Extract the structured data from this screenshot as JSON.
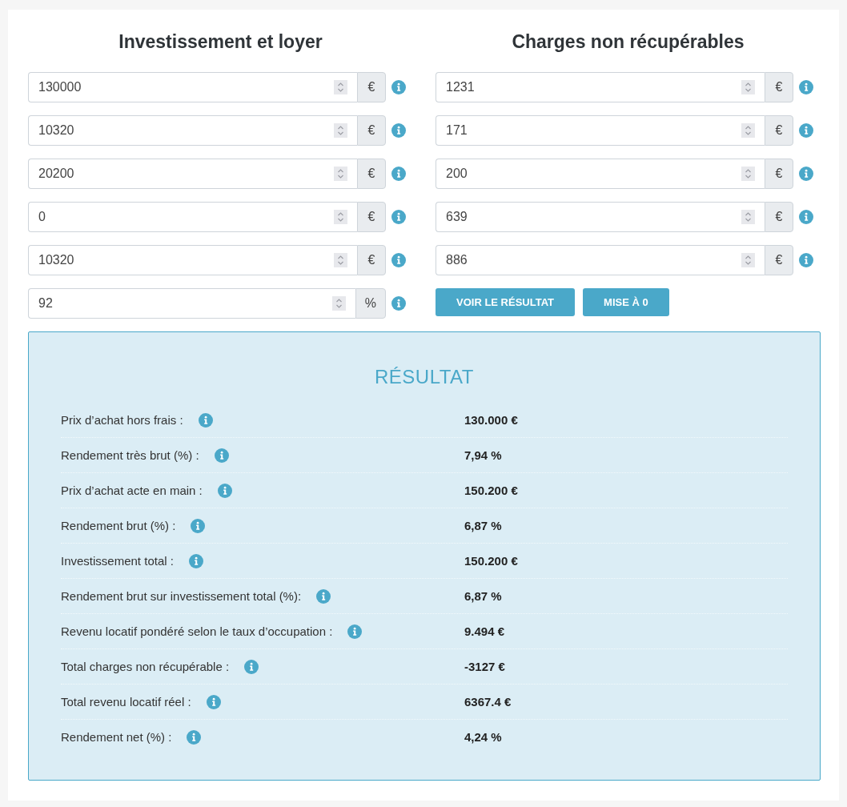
{
  "sections": [
    {
      "title": "Investissement et loyer",
      "fields": [
        {
          "value": "130000",
          "unit": "€"
        },
        {
          "value": "10320",
          "unit": "€"
        },
        {
          "value": "20200",
          "unit": "€"
        },
        {
          "value": "0",
          "unit": "€"
        },
        {
          "value": "10320",
          "unit": "€"
        },
        {
          "value": "92",
          "unit": "%"
        }
      ]
    },
    {
      "title": "Charges non récupérables",
      "fields": [
        {
          "value": "1231",
          "unit": "€"
        },
        {
          "value": "171",
          "unit": "€"
        },
        {
          "value": "200",
          "unit": "€"
        },
        {
          "value": "639",
          "unit": "€"
        },
        {
          "value": "886",
          "unit": "€"
        }
      ],
      "buttons": [
        {
          "label": "VOIR LE RÉSULTAT"
        },
        {
          "label": "MISE À 0"
        }
      ]
    }
  ],
  "result": {
    "title": "RÉSULTAT",
    "rows": [
      {
        "label": "Prix d’achat hors frais :",
        "value": "130.000 €"
      },
      {
        "label": "Rendement très brut (%) :",
        "value": "7,94 %"
      },
      {
        "label": "Prix d’achat acte en main :",
        "value": "150.200 €"
      },
      {
        "label": "Rendement brut (%) :",
        "value": "6,87 %"
      },
      {
        "label": "Investissement total :",
        "value": "150.200 €"
      },
      {
        "label": "Rendement brut sur investissement total (%):",
        "value": "6,87 %"
      },
      {
        "label": "Revenu locatif pondéré selon le taux d’occupation :",
        "value": "9.494 €"
      },
      {
        "label": "Total charges non récupérable :",
        "value": "-3127 €"
      },
      {
        "label": "Total revenu locatif réel :",
        "value": "6367.4 €"
      },
      {
        "label": "Rendement net (%) :",
        "value": "4,24 %"
      }
    ]
  }
}
